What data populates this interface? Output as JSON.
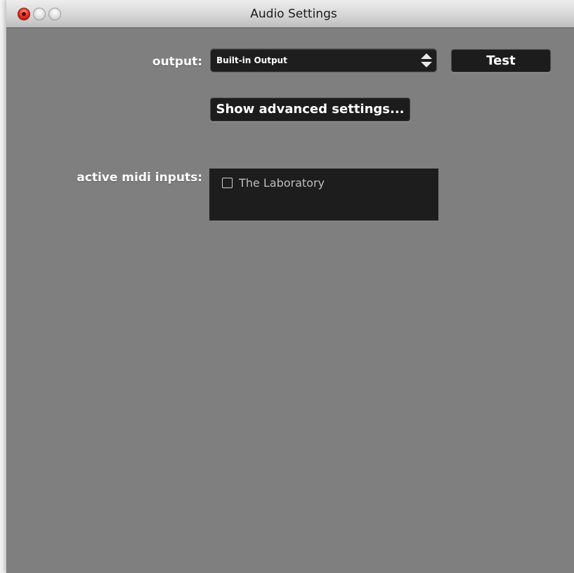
{
  "window": {
    "title": "Audio Settings"
  },
  "output": {
    "label": "output:",
    "selected": "Built-in Output"
  },
  "buttons": {
    "test_label": "Test",
    "advanced_label": "Show advanced settings..."
  },
  "midi": {
    "label": "active midi inputs:",
    "items": [
      {
        "label": "The Laboratory",
        "checked": false
      }
    ]
  },
  "icons": {
    "close": "close-icon",
    "minimize": "minimize-icon",
    "zoom": "zoom-icon",
    "select_stepper": "updown-arrows-icon"
  },
  "colors": {
    "window_background": "#7f7f7f",
    "control_background": "#1c1c1c",
    "label_text": "#ffffff",
    "list_item_text": "#bdbdbd",
    "close_button": "#e3271b"
  }
}
